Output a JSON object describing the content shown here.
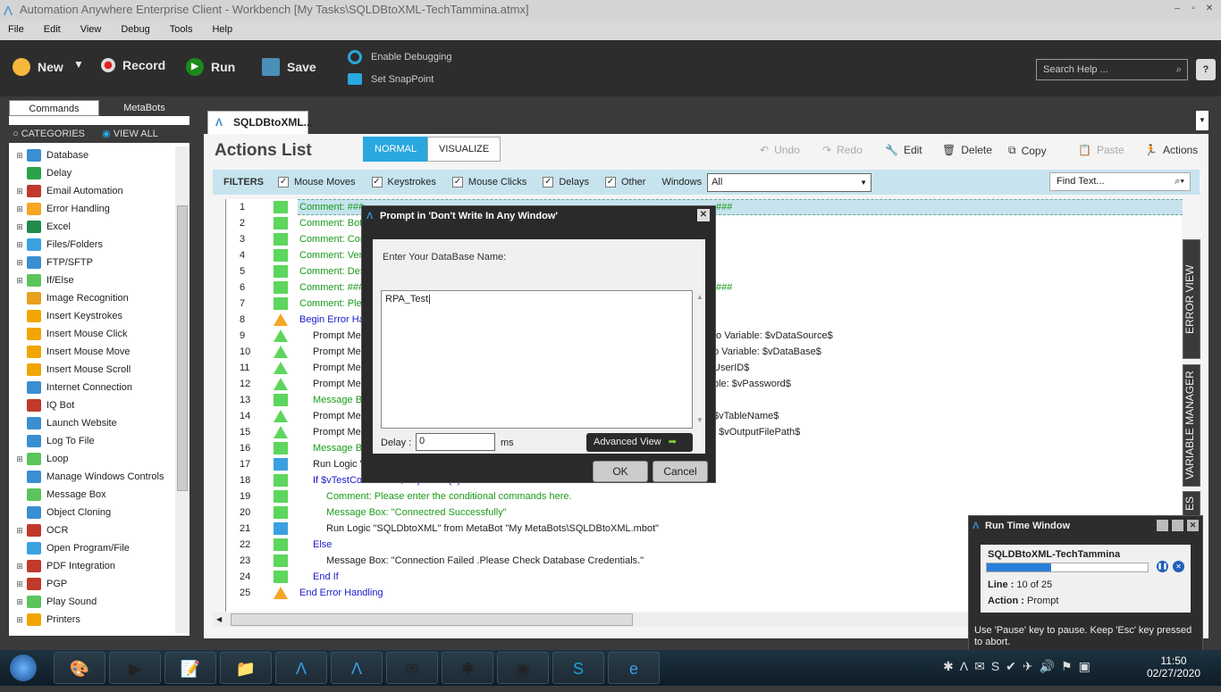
{
  "window": {
    "title": "Automation Anywhere Enterprise Client - Workbench [My Tasks\\SQLDBtoXML-TechTammina.atmx]"
  },
  "menu": [
    "File",
    "Edit",
    "View",
    "Debug",
    "Tools",
    "Help"
  ],
  "toolbar": {
    "new": "New",
    "record": "Record",
    "run": "Run",
    "save": "Save",
    "enable_debugging": "Enable Debugging",
    "set_snappoint": "Set SnapPoint",
    "search_placeholder": "Search Help ...",
    "help": "?"
  },
  "left_panel": {
    "tabs": [
      "Commands",
      "MetaBots"
    ],
    "categories": "CATEGORIES",
    "view_all": "VIEW ALL",
    "commands": [
      {
        "label": "Database",
        "color": "#3a8fd0",
        "exp": true
      },
      {
        "label": "Delay",
        "color": "#2aa34a",
        "exp": false
      },
      {
        "label": "Email Automation",
        "color": "#c0392b",
        "exp": true
      },
      {
        "label": "Error Handling",
        "color": "#f5a623",
        "exp": true
      },
      {
        "label": "Excel",
        "color": "#1f8a4c",
        "exp": true
      },
      {
        "label": "Files/Folders",
        "color": "#3aa0e0",
        "exp": true
      },
      {
        "label": "FTP/SFTP",
        "color": "#3a8fd0",
        "exp": true
      },
      {
        "label": "If/Else",
        "color": "#5cc45c",
        "exp": true
      },
      {
        "label": "Image Recognition",
        "color": "#e8a020",
        "exp": false
      },
      {
        "label": "Insert Keystrokes",
        "color": "#f0a500",
        "exp": false
      },
      {
        "label": "Insert Mouse Click",
        "color": "#f0a500",
        "exp": false
      },
      {
        "label": "Insert Mouse Move",
        "color": "#f0a500",
        "exp": false
      },
      {
        "label": "Insert Mouse Scroll",
        "color": "#f0a500",
        "exp": false
      },
      {
        "label": "Internet Connection",
        "color": "#3a8fd0",
        "exp": false
      },
      {
        "label": "IQ Bot",
        "color": "#c0392b",
        "exp": false
      },
      {
        "label": "Launch Website",
        "color": "#3a8fd0",
        "exp": false
      },
      {
        "label": "Log To File",
        "color": "#3a8fd0",
        "exp": false
      },
      {
        "label": "Loop",
        "color": "#5cc45c",
        "exp": true
      },
      {
        "label": "Manage Windows Controls",
        "color": "#3a8fd0",
        "exp": false
      },
      {
        "label": "Message Box",
        "color": "#5cc45c",
        "exp": false
      },
      {
        "label": "Object Cloning",
        "color": "#3a8fd0",
        "exp": false
      },
      {
        "label": "OCR",
        "color": "#c0392b",
        "exp": true
      },
      {
        "label": "Open Program/File",
        "color": "#3aa0e0",
        "exp": false
      },
      {
        "label": "PDF Integration",
        "color": "#c0392b",
        "exp": true
      },
      {
        "label": "PGP",
        "color": "#c0392b",
        "exp": true
      },
      {
        "label": "Play Sound",
        "color": "#5cc45c",
        "exp": true
      },
      {
        "label": "Printers",
        "color": "#f0a500",
        "exp": true
      }
    ]
  },
  "main": {
    "tab": "SQLDBtoXML...",
    "title": "Actions List",
    "modes": [
      "NORMAL",
      "VISUALIZE"
    ],
    "actions": [
      "Undo",
      "Redo",
      "Edit",
      "Delete",
      "Copy",
      "Paste",
      "Actions"
    ],
    "filters": {
      "label": "FILTERS",
      "items": [
        "Mouse Moves",
        "Keystrokes",
        "Mouse Clicks",
        "Delays",
        "Other"
      ],
      "windows_label": "Windows",
      "windows_value": "All",
      "find_placeholder": "Find Text..."
    },
    "side_tabs": [
      "ERROR VIEW",
      "VARIABLE MANAGER",
      "ES"
    ],
    "lines": [
      {
        "n": "1",
        "text": "Comment: ###",
        "tail": "###",
        "kind": "comment",
        "indent": 0
      },
      {
        "n": "2",
        "text": "Comment: Bot I",
        "tail": "",
        "kind": "comment",
        "indent": 0
      },
      {
        "n": "3",
        "text": "Comment: Com",
        "tail": "",
        "kind": "comment",
        "indent": 0
      },
      {
        "n": "4",
        "text": "Comment: Vers",
        "tail": "",
        "kind": "comment",
        "indent": 0
      },
      {
        "n": "5",
        "text": "Comment: Desc",
        "tail": "",
        "kind": "comment",
        "indent": 0
      },
      {
        "n": "6",
        "text": "Comment: ###",
        "tail": "###",
        "kind": "comment",
        "indent": 0
      },
      {
        "n": "7",
        "text": "Comment: Plea",
        "tail": "",
        "kind": "comment",
        "indent": 0
      },
      {
        "n": "8",
        "text": "Begin Error Han",
        "tail": "",
        "kind": "error",
        "indent": 0
      },
      {
        "n": "9",
        "text": "Prompt Mes",
        "tail": "to Variable: $vDataSource$",
        "kind": "prompt",
        "indent": 1
      },
      {
        "n": "10",
        "text": "Prompt Mes",
        "tail": "o Variable: $vDataBase$",
        "kind": "prompt",
        "indent": 1
      },
      {
        "n": "11",
        "text": "Prompt Mes",
        "tail": "UserID$",
        "kind": "prompt",
        "indent": 1
      },
      {
        "n": "12",
        "text": "Prompt Mes",
        "tail": "ble: $vPassword$",
        "kind": "prompt",
        "indent": 1
      },
      {
        "n": "13",
        "text": "Message Bo",
        "tail": "",
        "kind": "msg",
        "indent": 1
      },
      {
        "n": "14",
        "text": "Prompt Mes",
        "tail": "$vTableName$",
        "kind": "prompt",
        "indent": 1
      },
      {
        "n": "15",
        "text": "Prompt Mes",
        "tail": ": $vOutputFilePath$",
        "kind": "prompt",
        "indent": 1
      },
      {
        "n": "16",
        "text": "Message Bo",
        "tail": "",
        "kind": "msg",
        "indent": 1
      },
      {
        "n": "17",
        "text": "Run Logic \"",
        "tail": "",
        "kind": "run",
        "indent": 1
      },
      {
        "n": "18",
        "text": "If $vTestConnection$ Equal To (=) \"true\" Then",
        "tail": "",
        "kind": "if",
        "indent": 1
      },
      {
        "n": "19",
        "text": "Comment: Please enter the conditional commands here.",
        "tail": "",
        "kind": "comment",
        "indent": 2
      },
      {
        "n": "20",
        "text": "Message Box: \"Connectred Successfully\"",
        "tail": "",
        "kind": "msg",
        "indent": 2
      },
      {
        "n": "21",
        "text": "Run Logic \"SQLDbtoXML\" from MetaBot \"My MetaBots\\SQLDBtoXML.mbot\"",
        "tail": "",
        "kind": "run",
        "indent": 2
      },
      {
        "n": "22",
        "text": "Else",
        "tail": "",
        "kind": "else",
        "indent": 1
      },
      {
        "n": "23",
        "text": "Message Box: \"Connection Failed .Please Check Database Credentials.\"",
        "tail": "",
        "kind": "msgblack",
        "indent": 2
      },
      {
        "n": "24",
        "text": "End If",
        "tail": "",
        "kind": "endif",
        "indent": 1
      },
      {
        "n": "25",
        "text": "End Error Handling",
        "tail": "",
        "kind": "error",
        "indent": 0
      }
    ]
  },
  "dialog": {
    "title": "Prompt in 'Don't Write In Any Window'",
    "prompt": "Enter Your DataBase Name:",
    "value": "RPA_Test",
    "delay_label": "Delay :",
    "delay_value": "0",
    "ms": "ms",
    "advanced": "Advanced View",
    "ok": "OK",
    "cancel": "Cancel"
  },
  "runtime": {
    "title": "Run Time Window",
    "task": "SQLDBtoXML-TechTammina",
    "progress": 0.4,
    "line_label": "Line :",
    "line_value": "10 of 25",
    "action_label": "Action :",
    "action_value": "Prompt",
    "hint": "Use 'Pause' key to pause. Keep 'Esc' key pressed to abort."
  },
  "clock": {
    "time": "11:50",
    "date": "02/27/2020"
  }
}
